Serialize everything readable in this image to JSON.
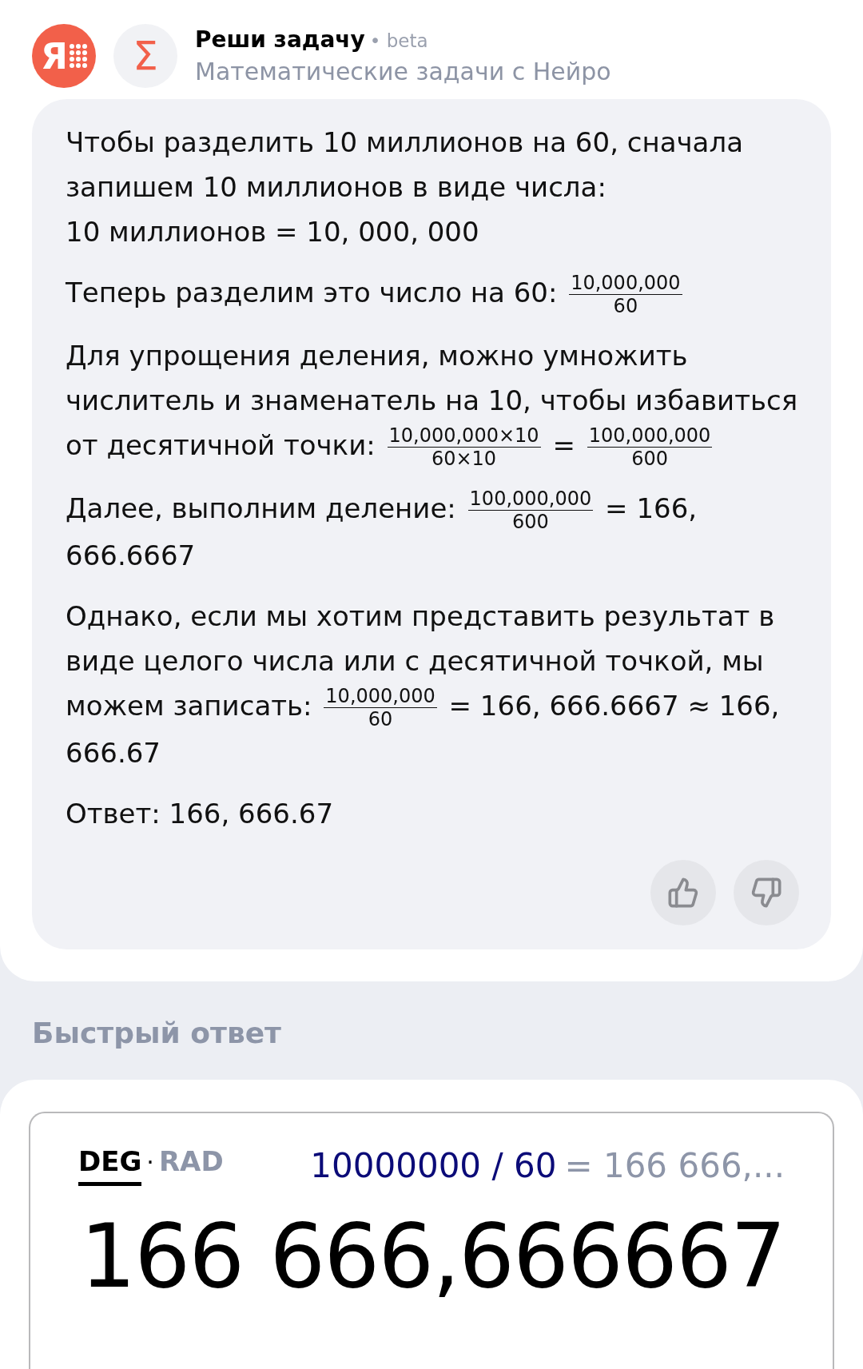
{
  "header": {
    "logo_letter": "Я",
    "skill_icon": "Σ",
    "title": "Реши задачу",
    "badge": "• beta",
    "subtitle": "Математические задачи с Нейро"
  },
  "answer": {
    "paragraphs": [
      {
        "segments": [
          {
            "kind": "text",
            "text": "Чтобы разделить 10 миллионов на 60, сначала запишем 10 миллионов в виде числа:"
          },
          {
            "kind": "break"
          },
          {
            "kind": "text",
            "text": "10 миллионов = 10, 000, 000"
          }
        ]
      },
      {
        "segments": [
          {
            "kind": "text",
            "text": "Теперь разделим это число на 60: "
          },
          {
            "kind": "frac",
            "num": "10,000,000",
            "den": "60"
          }
        ]
      },
      {
        "segments": [
          {
            "kind": "text",
            "text": "Для упрощения деления, можно умножить числитель и знаменатель на 10, чтобы избавиться от десятичной точки: "
          },
          {
            "kind": "frac",
            "num": "10,000,000×10",
            "den": "60×10"
          },
          {
            "kind": "text",
            "text": " = "
          },
          {
            "kind": "frac",
            "num": "100,000,000",
            "den": "600"
          }
        ]
      },
      {
        "segments": [
          {
            "kind": "text",
            "text": "Далее, выполним деление: "
          },
          {
            "kind": "frac",
            "num": "100,000,000",
            "den": "600"
          },
          {
            "kind": "text",
            "text": " = 166, 666.6667"
          }
        ]
      },
      {
        "segments": [
          {
            "kind": "text",
            "text": "Однако, если мы хотим представить результат в виде целого числа или с десятичной точкой, мы можем записать: "
          },
          {
            "kind": "frac",
            "num": "10,000,000",
            "den": "60"
          },
          {
            "kind": "text",
            "text": " = 166, 666.6667 ≈ 166, 666.67"
          }
        ]
      },
      {
        "segments": [
          {
            "kind": "text",
            "text": "Ответ: 166, 666.67"
          }
        ]
      }
    ]
  },
  "quick_answer": {
    "heading": "Быстрый ответ",
    "modes": [
      {
        "label": "DEG",
        "selected": true
      },
      {
        "label": "RAD",
        "selected": false
      }
    ],
    "mode_separator": "·",
    "expression": "10000000 / 60",
    "preview": "= 166 666,...",
    "result": "166 666,666667"
  }
}
